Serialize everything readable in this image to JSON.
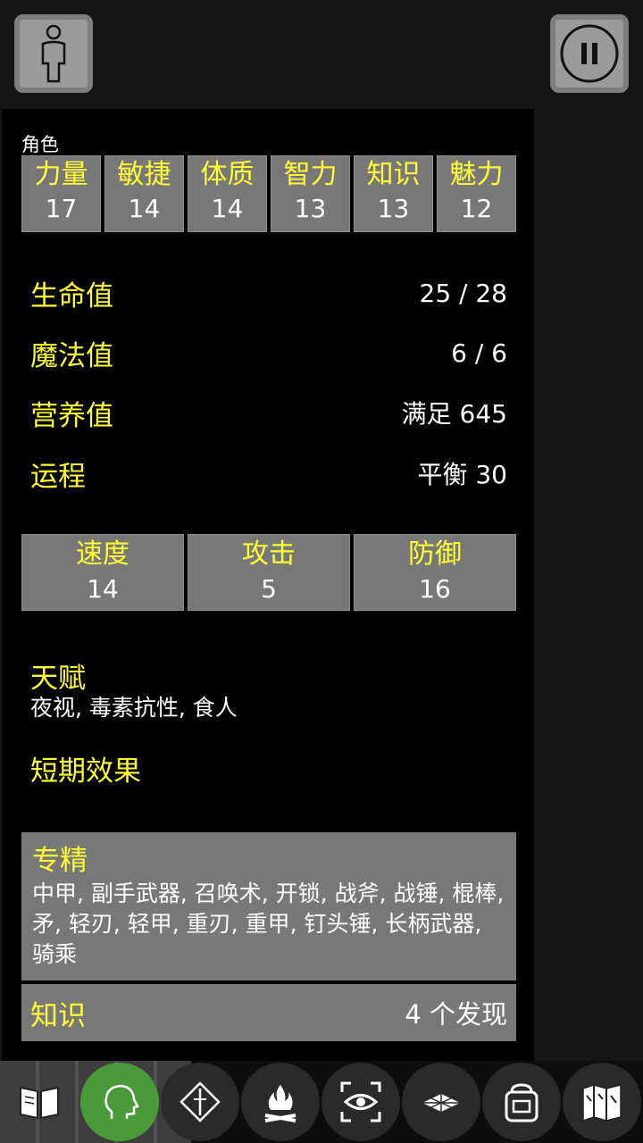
{
  "panel": {
    "title": "角色"
  },
  "attributes": [
    {
      "label": "力量",
      "value": "17"
    },
    {
      "label": "敏捷",
      "value": "14"
    },
    {
      "label": "体质",
      "value": "14"
    },
    {
      "label": "智力",
      "value": "13"
    },
    {
      "label": "知识",
      "value": "13"
    },
    {
      "label": "魅力",
      "value": "12"
    }
  ],
  "stats": [
    {
      "label": "生命值",
      "value": "25 / 28"
    },
    {
      "label": "魔法值",
      "value": "6 / 6"
    },
    {
      "label": "营养值",
      "value": "满足 645"
    },
    {
      "label": "运程",
      "value": "平衡 30"
    }
  ],
  "combat": [
    {
      "label": "速度",
      "value": "14"
    },
    {
      "label": "攻击",
      "value": "5"
    },
    {
      "label": "防御",
      "value": "16"
    }
  ],
  "talents": {
    "title": "天赋",
    "text": "夜视, 毒素抗性, 食人"
  },
  "short_effects": {
    "title": "短期效果"
  },
  "specialization": {
    "title": "专精",
    "text": "中甲, 副手武器, 召唤术, 开锁, 战斧, 战锤, 棍棒, 矛, 轻刃, 轻甲, 重刃, 重甲, 钉头锤, 长柄武器, 骑乘"
  },
  "knowledge": {
    "label": "知识",
    "value": "4 个发现"
  },
  "icons": {
    "top_left": "character-icon",
    "top_right": "pause-icon",
    "bottom": [
      "journal-icon",
      "head-icon",
      "compass-icon",
      "campfire-icon",
      "look-icon",
      "map-tiles-icon",
      "inventory-icon",
      "world-map-icon"
    ]
  },
  "colors": {
    "label_yellow": "#ffff33",
    "cell_gray": "#787878",
    "panel_bg": "#000000",
    "active_green": "#4a9a3a"
  }
}
